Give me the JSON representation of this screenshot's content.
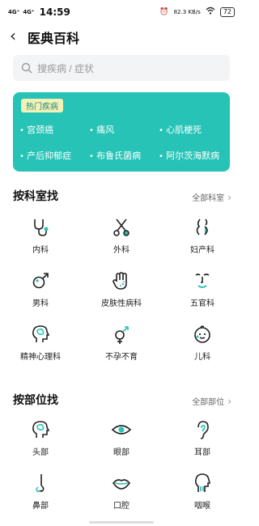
{
  "status_bar": {
    "network_1": "4G⁺",
    "network_2": "4G⁺",
    "time": "14:59",
    "speed": "82.3 KB/s",
    "battery": "72"
  },
  "header": {
    "title": "医典百科"
  },
  "search": {
    "placeholder": "搜疾病 / 症状"
  },
  "hot": {
    "tag": "热门疾病",
    "items": [
      "宫颈癌",
      "痛风",
      "心肌梗死",
      "产后抑郁症",
      "布鲁氏菌病",
      "阿尔茨海默病"
    ]
  },
  "dept": {
    "title": "按科室找",
    "more": "全部科室",
    "items": [
      {
        "label": "内科",
        "icon": "stethoscope-icon"
      },
      {
        "label": "外科",
        "icon": "scissors-icon"
      },
      {
        "label": "妇产科",
        "icon": "pregnancy-icon"
      },
      {
        "label": "男科",
        "icon": "male-icon"
      },
      {
        "label": "皮肤性病科",
        "icon": "hand-icon"
      },
      {
        "label": "五官科",
        "icon": "face-icon"
      },
      {
        "label": "精神心理科",
        "icon": "head-brain-icon"
      },
      {
        "label": "不孕不育",
        "icon": "gender-icon"
      },
      {
        "label": "儿科",
        "icon": "baby-icon"
      }
    ]
  },
  "body": {
    "title": "按部位找",
    "more": "全部部位",
    "items": [
      {
        "label": "头部",
        "icon": "head-icon"
      },
      {
        "label": "眼部",
        "icon": "eye-icon"
      },
      {
        "label": "耳部",
        "icon": "ear-icon"
      },
      {
        "label": "鼻部",
        "icon": "nose-icon"
      },
      {
        "label": "口腔",
        "icon": "mouth-icon"
      },
      {
        "label": "咽喉",
        "icon": "throat-icon"
      }
    ]
  },
  "colors": {
    "accent": "#26c3b6",
    "tag_bg": "#f4f1b6"
  }
}
